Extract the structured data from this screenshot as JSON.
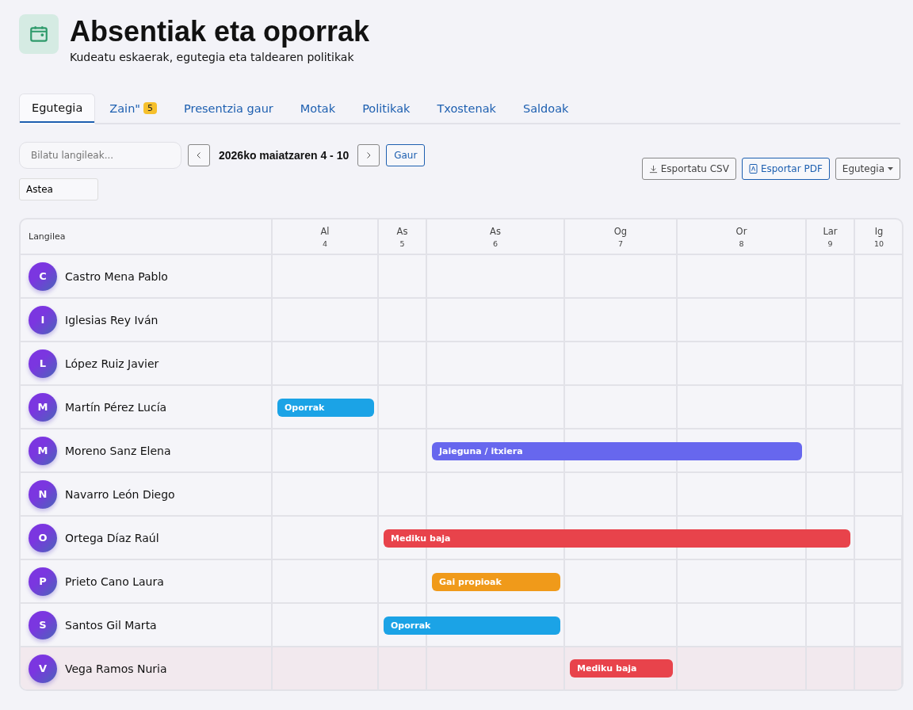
{
  "header": {
    "title": "Absentiak eta oporrak",
    "subtitle": "Kudeatu eskaerak, egutegia eta taldearen politikak"
  },
  "tabs": [
    {
      "label": "Egutegia",
      "selected": true
    },
    {
      "label": "Zain\"",
      "badge": "5",
      "selected": false
    },
    {
      "label": "Presentzia gaur",
      "selected": false
    },
    {
      "label": "Motak",
      "selected": false
    },
    {
      "label": "Politikak",
      "selected": false
    },
    {
      "label": "Txostenak",
      "selected": false
    },
    {
      "label": "Saldoak",
      "selected": false
    }
  ],
  "toolbar": {
    "search": {
      "placeholder": "Bilatu langileak..."
    },
    "range": "2026ko maiatzaren 4 - 10",
    "today": "Gaur",
    "view": "Astea",
    "export_csv": "Esportatu CSV",
    "export_pdf": "Esportar PDF",
    "mode": "Egutegia"
  },
  "calendar": {
    "name_column": "Langilea",
    "days": [
      {
        "weekday": "Al",
        "day": "4"
      },
      {
        "weekday": "As",
        "day": "5"
      },
      {
        "weekday": "As",
        "day": "6"
      },
      {
        "weekday": "Og",
        "day": "7"
      },
      {
        "weekday": "Or",
        "day": "8"
      },
      {
        "weekday": "Lar",
        "day": "9"
      },
      {
        "weekday": "Ig",
        "day": "10"
      }
    ],
    "rows": [
      {
        "initial": "C",
        "name": "Castro Mena Pablo",
        "highlighted": false,
        "absences": []
      },
      {
        "initial": "I",
        "name": "Iglesias Rey Iván",
        "highlighted": false,
        "absences": []
      },
      {
        "initial": "L",
        "name": "López Ruiz Javier",
        "highlighted": false,
        "absences": []
      },
      {
        "initial": "M",
        "name": "Martín Pérez Lucía",
        "highlighted": false,
        "absences": [
          {
            "label": "Oporrak",
            "color": "#1ba3e6",
            "covers": [
              true,
              false,
              false,
              false,
              false,
              false,
              false
            ]
          }
        ]
      },
      {
        "initial": "M",
        "name": "Moreno Sanz Elena",
        "highlighted": false,
        "absences": [
          {
            "label": "Jaieguna / itxiera",
            "color": "#6767ee",
            "covers": [
              false,
              false,
              true,
              true,
              true,
              false,
              false
            ]
          }
        ]
      },
      {
        "initial": "N",
        "name": "Navarro León Diego",
        "highlighted": false,
        "absences": []
      },
      {
        "initial": "O",
        "name": "Ortega Díaz Raúl",
        "highlighted": false,
        "absences": [
          {
            "label": "Mediku baja",
            "color": "#e8434b",
            "covers": [
              false,
              true,
              true,
              true,
              true,
              true,
              false
            ]
          }
        ]
      },
      {
        "initial": "P",
        "name": "Prieto Cano Laura",
        "highlighted": false,
        "absences": [
          {
            "label": "Gai propioak",
            "color": "#f09a1a",
            "covers": [
              false,
              false,
              true,
              false,
              false,
              false,
              false
            ]
          }
        ]
      },
      {
        "initial": "S",
        "name": "Santos Gil Marta",
        "highlighted": false,
        "absences": [
          {
            "label": "Oporrak",
            "color": "#1ba3e6",
            "covers": [
              false,
              true,
              true,
              false,
              false,
              false,
              false
            ]
          }
        ]
      },
      {
        "initial": "V",
        "name": "Vega Ramos Nuria",
        "highlighted": true,
        "absences": [
          {
            "label": "Mediku baja",
            "color": "#e8434b",
            "covers": [
              false,
              false,
              false,
              true,
              false,
              false,
              false
            ]
          }
        ]
      }
    ]
  }
}
